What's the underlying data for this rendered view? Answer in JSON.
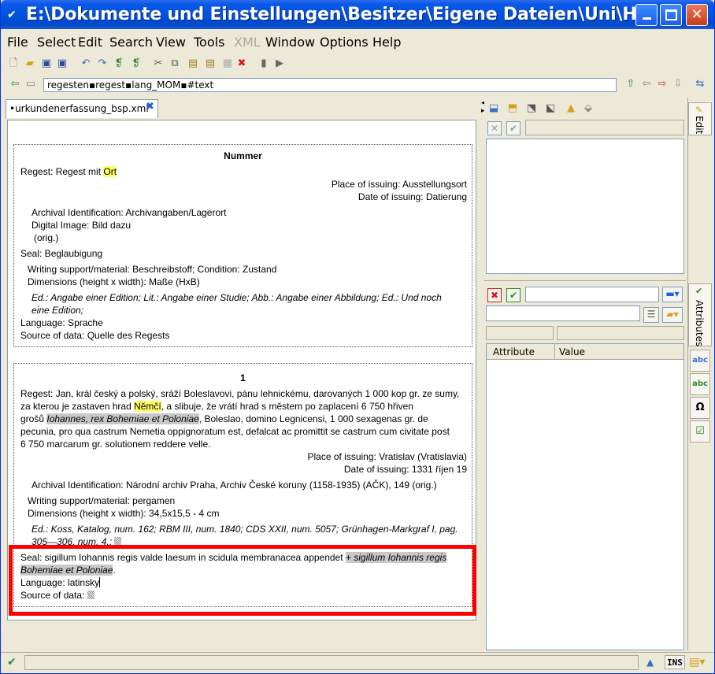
{
  "window": {
    "title": "E:\\Dokumente und Einstellungen\\Besitzer\\Eigene Dateien\\Uni\\His...",
    "min_label": "_",
    "max_label": "□",
    "close_label": "✕"
  },
  "menu": [
    {
      "label": "File",
      "disabled": false
    },
    {
      "label": "Select",
      "disabled": false
    },
    {
      "label": "Edit",
      "disabled": false
    },
    {
      "label": "Search",
      "disabled": false
    },
    {
      "label": "View",
      "disabled": false
    },
    {
      "label": "Tools",
      "disabled": false
    },
    {
      "label": "XML",
      "disabled": true
    },
    {
      "label": "Window",
      "disabled": false
    },
    {
      "label": "Options",
      "disabled": false
    },
    {
      "label": "Help",
      "disabled": false
    }
  ],
  "path": {
    "value": "regesten▪regest▪lang_MOM▪#text"
  },
  "tab": {
    "label": "urkundenerfassung_bsp.xml",
    "close": "✖"
  },
  "doc1": {
    "heading": "Nummer",
    "regest_prefix": "Regest: Regest mit ",
    "regest_hl": "Ort",
    "place": "Place of issuing: Ausstellungsort",
    "date": "Date of issuing: Datierung",
    "archival": "Archival Identification: Archivangaben/Lagerort",
    "image": "Digital Image: Bild dazu",
    "orig": "(orig.)",
    "seal": "Seal: Beglaubigung",
    "writing": "Writing support/material: Beschreibstoff; Condition: Zustand",
    "dimensions": "Dimensions (height x width): Maße (HxB)",
    "ed_line1": "Ed.: Angabe einer Edition;  Lit.: Angabe einer Studie; Abb.: Angabe einer Abbildung;  Ed.: Und noch",
    "ed_line2": "eine Edition;",
    "language": "Language: Sprache",
    "source": "Source of data: Quelle des Regests"
  },
  "doc2": {
    "heading": "1",
    "regest_l1": "Regest: Jan, král český a polský, sráží Boleslavovi, pánu lehnickému, darovaných 1 000 kop gr. ze sumy,",
    "regest_l2a": "za kterou je zastaven hrad ",
    "regest_l2hl": "Němčí",
    "regest_l2b": ", a slibuje, že vrátí hrad s městem po zaplacení 6 750 hřiven",
    "regest_l3a": "grošů ",
    "regest_l3gr": "Iohannes, rex Bohemiae et Poloniae",
    "regest_l3b": ", Boleslao, domino Legnicensi, 1 000 sexagenas gr. de",
    "regest_l4": "pecunia, pro qua castrum Nemetia oppignoratum est, defalcat ac promittit se castrum cum civitate post",
    "regest_l5": "6 750 marcarum gr. solutionem reddere velle.",
    "place": "Place of issuing: Vratislav (Vratislavia)",
    "date": "Date of issuing: 1331 říjen 19",
    "archival": "Archival Identification: Národní archiv Praha, Archiv České koruny (1158-1935) (AČK), 149 (orig.)",
    "writing": "Writing support/material: pergamen",
    "dimensions": "Dimensions (height x width): 34,5x15,5 - 4 cm",
    "ed_line1": "Ed.: Koss, Katalog, num. 162; RBM III, num. 1840; CDS XXII, num. 5057; Grünhagen-Markgraf I, pag.",
    "ed_line2": "305—306, num. 4.; ",
    "seal_a": "Seal: sigillum Iohannis regis valde laesum in scidula membranacea appendet ",
    "seal_gr1": "+ sigillum Iohannis regis",
    "seal_gr2": "Bohemiae et Poloniae",
    "seal_end": ".",
    "language": "Language: latinsky",
    "source": "Source of data: "
  },
  "attributes": {
    "col_attribute": "Attribute",
    "col_value": "Value"
  },
  "sidetabs": {
    "edit": "Edit",
    "attributes": "Attributes",
    "omega": "Ω"
  },
  "status": {
    "ins": "INS"
  },
  "colors": {
    "highlight": "#ffff66",
    "annotation_frame": "#ff0000",
    "titlebar": "#0053e1"
  }
}
